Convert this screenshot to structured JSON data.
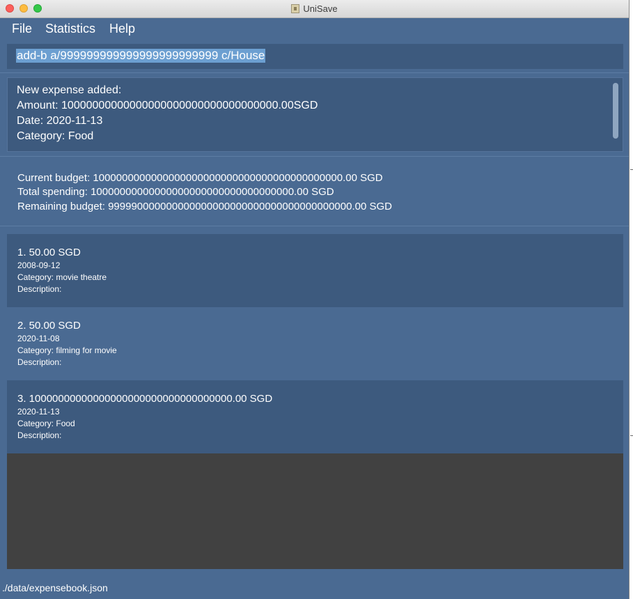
{
  "window": {
    "title": "UniSave"
  },
  "menu": {
    "items": [
      "File",
      "Statistics",
      "Help"
    ]
  },
  "command": {
    "value": "add-b a/999999999999999999999999 c/House"
  },
  "result": {
    "lines": [
      "New expense added:",
      " Amount: 10000000000000000000000000000000000.00SGD",
      " Date: 2020-11-13",
      " Category: Food"
    ]
  },
  "budget": {
    "current": "Current budget: 1000000000000000000000000000000000000000000.00 SGD",
    "total": "Total spending: 10000000000000000000000000000000000.00 SGD",
    "remaining": "Remaining budget: 999990000000000000000000000000000000000000.00 SGD"
  },
  "expenses": [
    {
      "title": "1.  50.00 SGD",
      "date": "2008-09-12",
      "category": "Category: movie theatre",
      "description": "Description:"
    },
    {
      "title": "2.  50.00 SGD",
      "date": "2020-11-08",
      "category": "Category: filming for movie",
      "description": "Description:"
    },
    {
      "title": "3.  10000000000000000000000000000000000.00 SGD",
      "date": "2020-11-13",
      "category": "Category: Food",
      "description": "Description:"
    }
  ],
  "status": {
    "path": "./data/expensebook.json"
  }
}
